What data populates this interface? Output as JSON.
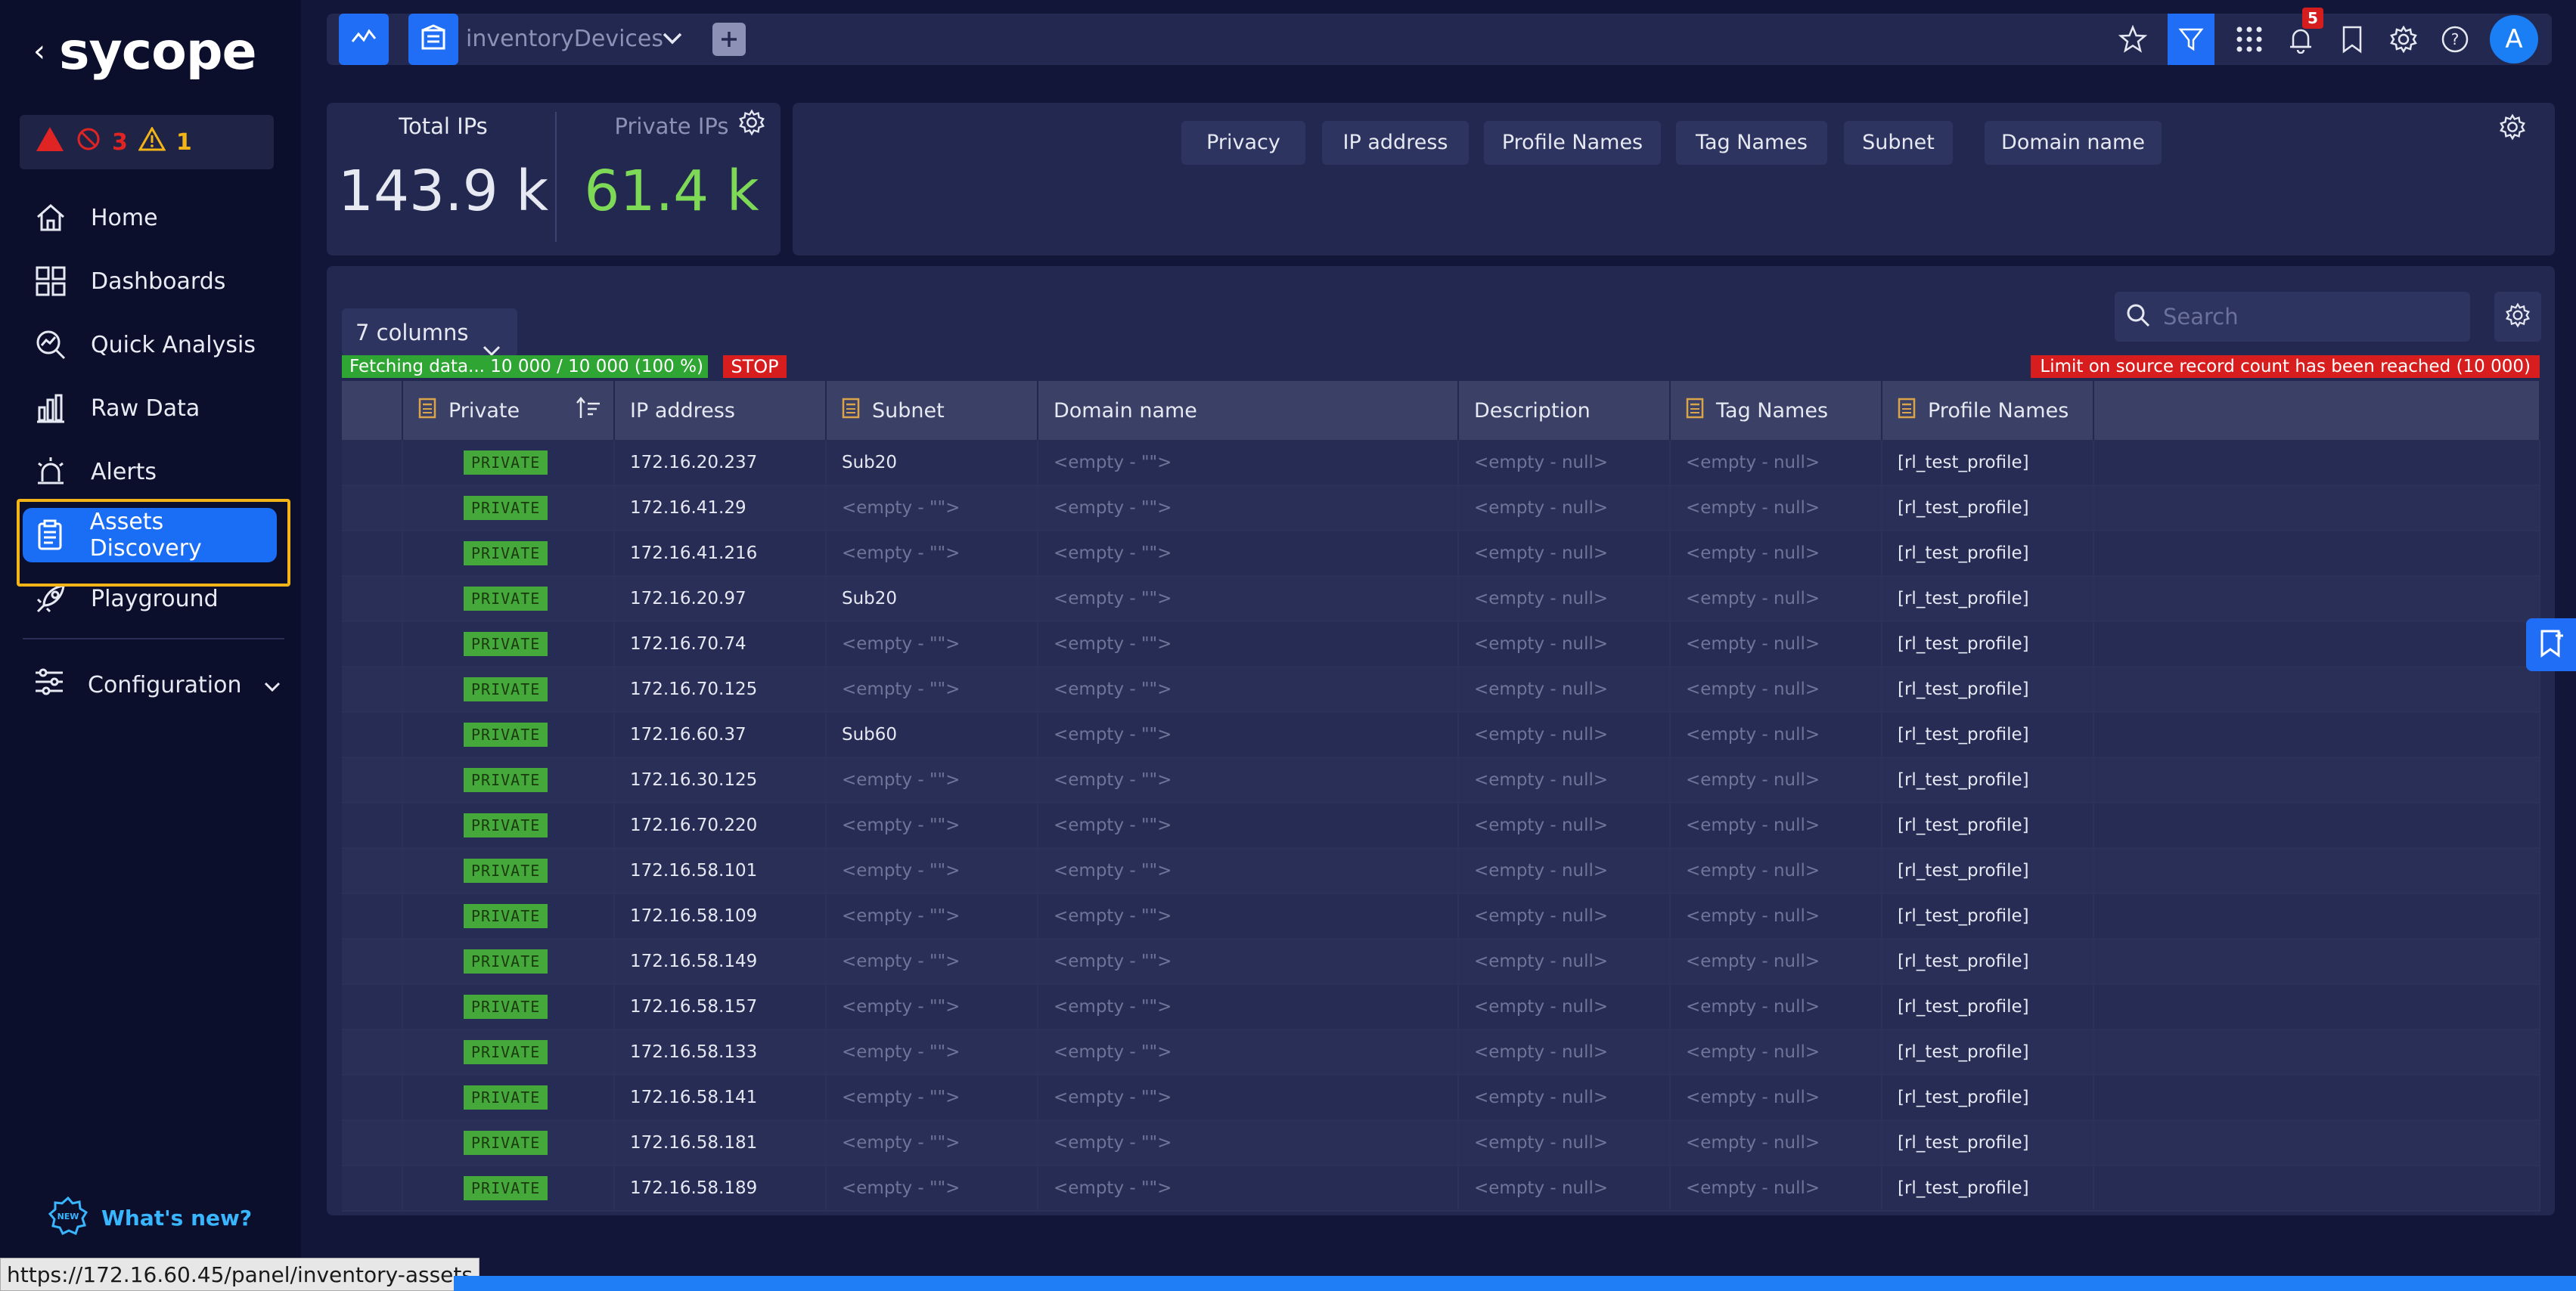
{
  "app": {
    "logo_text": "sycope",
    "back_glyph": "‹"
  },
  "alerts": {
    "error_count": "3",
    "warning_count": "1"
  },
  "sidebar": {
    "items": [
      {
        "label": "Home",
        "icon": "home-icon"
      },
      {
        "label": "Dashboards",
        "icon": "dashboard-icon"
      },
      {
        "label": "Quick Analysis",
        "icon": "analysis-icon"
      },
      {
        "label": "Raw Data",
        "icon": "bar-chart-icon"
      },
      {
        "label": "Alerts",
        "icon": "alarm-icon"
      },
      {
        "label": "Assets Discovery",
        "icon": "clipboard-icon",
        "active": true
      },
      {
        "label": "Playground",
        "icon": "rocket-icon"
      }
    ],
    "config_label": "Configuration",
    "whats_new": "What's new?"
  },
  "topbar": {
    "title": "inventoryDevices",
    "notification_count": "5",
    "avatar_letter": "A"
  },
  "stats": {
    "total_label": "Total IPs",
    "total_value": "143.9 k",
    "private_label": "Private IPs",
    "private_value": "61.4 k"
  },
  "filters": {
    "chips": [
      "Privacy",
      "IP address",
      "Profile Names",
      "Tag Names",
      "Subnet",
      "Domain name"
    ]
  },
  "table": {
    "columns_select": "7 columns",
    "fetch_status": "Fetching data... 10 000 / 10 000 (100 %)",
    "stop_label": "STOP",
    "limit_message": "Limit on source record count has been reached (10 000)",
    "search_placeholder": "Search",
    "headers": [
      "Private",
      "IP address",
      "Subnet",
      "Domain name",
      "Description",
      "Tag Names",
      "Profile Names"
    ],
    "rows": [
      [
        "PRIVATE",
        "172.16.20.237",
        "Sub20",
        "<empty - \"\">",
        "<empty - null>",
        "<empty - null>",
        "[rl_test_profile]"
      ],
      [
        "PRIVATE",
        "172.16.41.29",
        "<empty - \"\">",
        "<empty - \"\">",
        "<empty - null>",
        "<empty - null>",
        "[rl_test_profile]"
      ],
      [
        "PRIVATE",
        "172.16.41.216",
        "<empty - \"\">",
        "<empty - \"\">",
        "<empty - null>",
        "<empty - null>",
        "[rl_test_profile]"
      ],
      [
        "PRIVATE",
        "172.16.20.97",
        "Sub20",
        "<empty - \"\">",
        "<empty - null>",
        "<empty - null>",
        "[rl_test_profile]"
      ],
      [
        "PRIVATE",
        "172.16.70.74",
        "<empty - \"\">",
        "<empty - \"\">",
        "<empty - null>",
        "<empty - null>",
        "[rl_test_profile]"
      ],
      [
        "PRIVATE",
        "172.16.70.125",
        "<empty - \"\">",
        "<empty - \"\">",
        "<empty - null>",
        "<empty - null>",
        "[rl_test_profile]"
      ],
      [
        "PRIVATE",
        "172.16.60.37",
        "Sub60",
        "<empty - \"\">",
        "<empty - null>",
        "<empty - null>",
        "[rl_test_profile]"
      ],
      [
        "PRIVATE",
        "172.16.30.125",
        "<empty - \"\">",
        "<empty - \"\">",
        "<empty - null>",
        "<empty - null>",
        "[rl_test_profile]"
      ],
      [
        "PRIVATE",
        "172.16.70.220",
        "<empty - \"\">",
        "<empty - \"\">",
        "<empty - null>",
        "<empty - null>",
        "[rl_test_profile]"
      ],
      [
        "PRIVATE",
        "172.16.58.101",
        "<empty - \"\">",
        "<empty - \"\">",
        "<empty - null>",
        "<empty - null>",
        "[rl_test_profile]"
      ],
      [
        "PRIVATE",
        "172.16.58.109",
        "<empty - \"\">",
        "<empty - \"\">",
        "<empty - null>",
        "<empty - null>",
        "[rl_test_profile]"
      ],
      [
        "PRIVATE",
        "172.16.58.149",
        "<empty - \"\">",
        "<empty - \"\">",
        "<empty - null>",
        "<empty - null>",
        "[rl_test_profile]"
      ],
      [
        "PRIVATE",
        "172.16.58.157",
        "<empty - \"\">",
        "<empty - \"\">",
        "<empty - null>",
        "<empty - null>",
        "[rl_test_profile]"
      ],
      [
        "PRIVATE",
        "172.16.58.133",
        "<empty - \"\">",
        "<empty - \"\">",
        "<empty - null>",
        "<empty - null>",
        "[rl_test_profile]"
      ],
      [
        "PRIVATE",
        "172.16.58.141",
        "<empty - \"\">",
        "<empty - \"\">",
        "<empty - null>",
        "<empty - null>",
        "[rl_test_profile]"
      ],
      [
        "PRIVATE",
        "172.16.58.181",
        "<empty - \"\">",
        "<empty - \"\">",
        "<empty - null>",
        "<empty - null>",
        "[rl_test_profile]"
      ],
      [
        "PRIVATE",
        "172.16.58.189",
        "<empty - \"\">",
        "<empty - \"\">",
        "<empty - null>",
        "<empty - null>",
        "[rl_test_profile]"
      ]
    ]
  },
  "status_bar": {
    "url": "https://172.16.60.45/panel/inventory-assets"
  },
  "colors": {
    "accent": "#1f6ef5",
    "private_green": "#44a83b",
    "alert_red": "#d71d1d",
    "warning_yellow": "#f2b417",
    "value_green": "#7ed957"
  }
}
